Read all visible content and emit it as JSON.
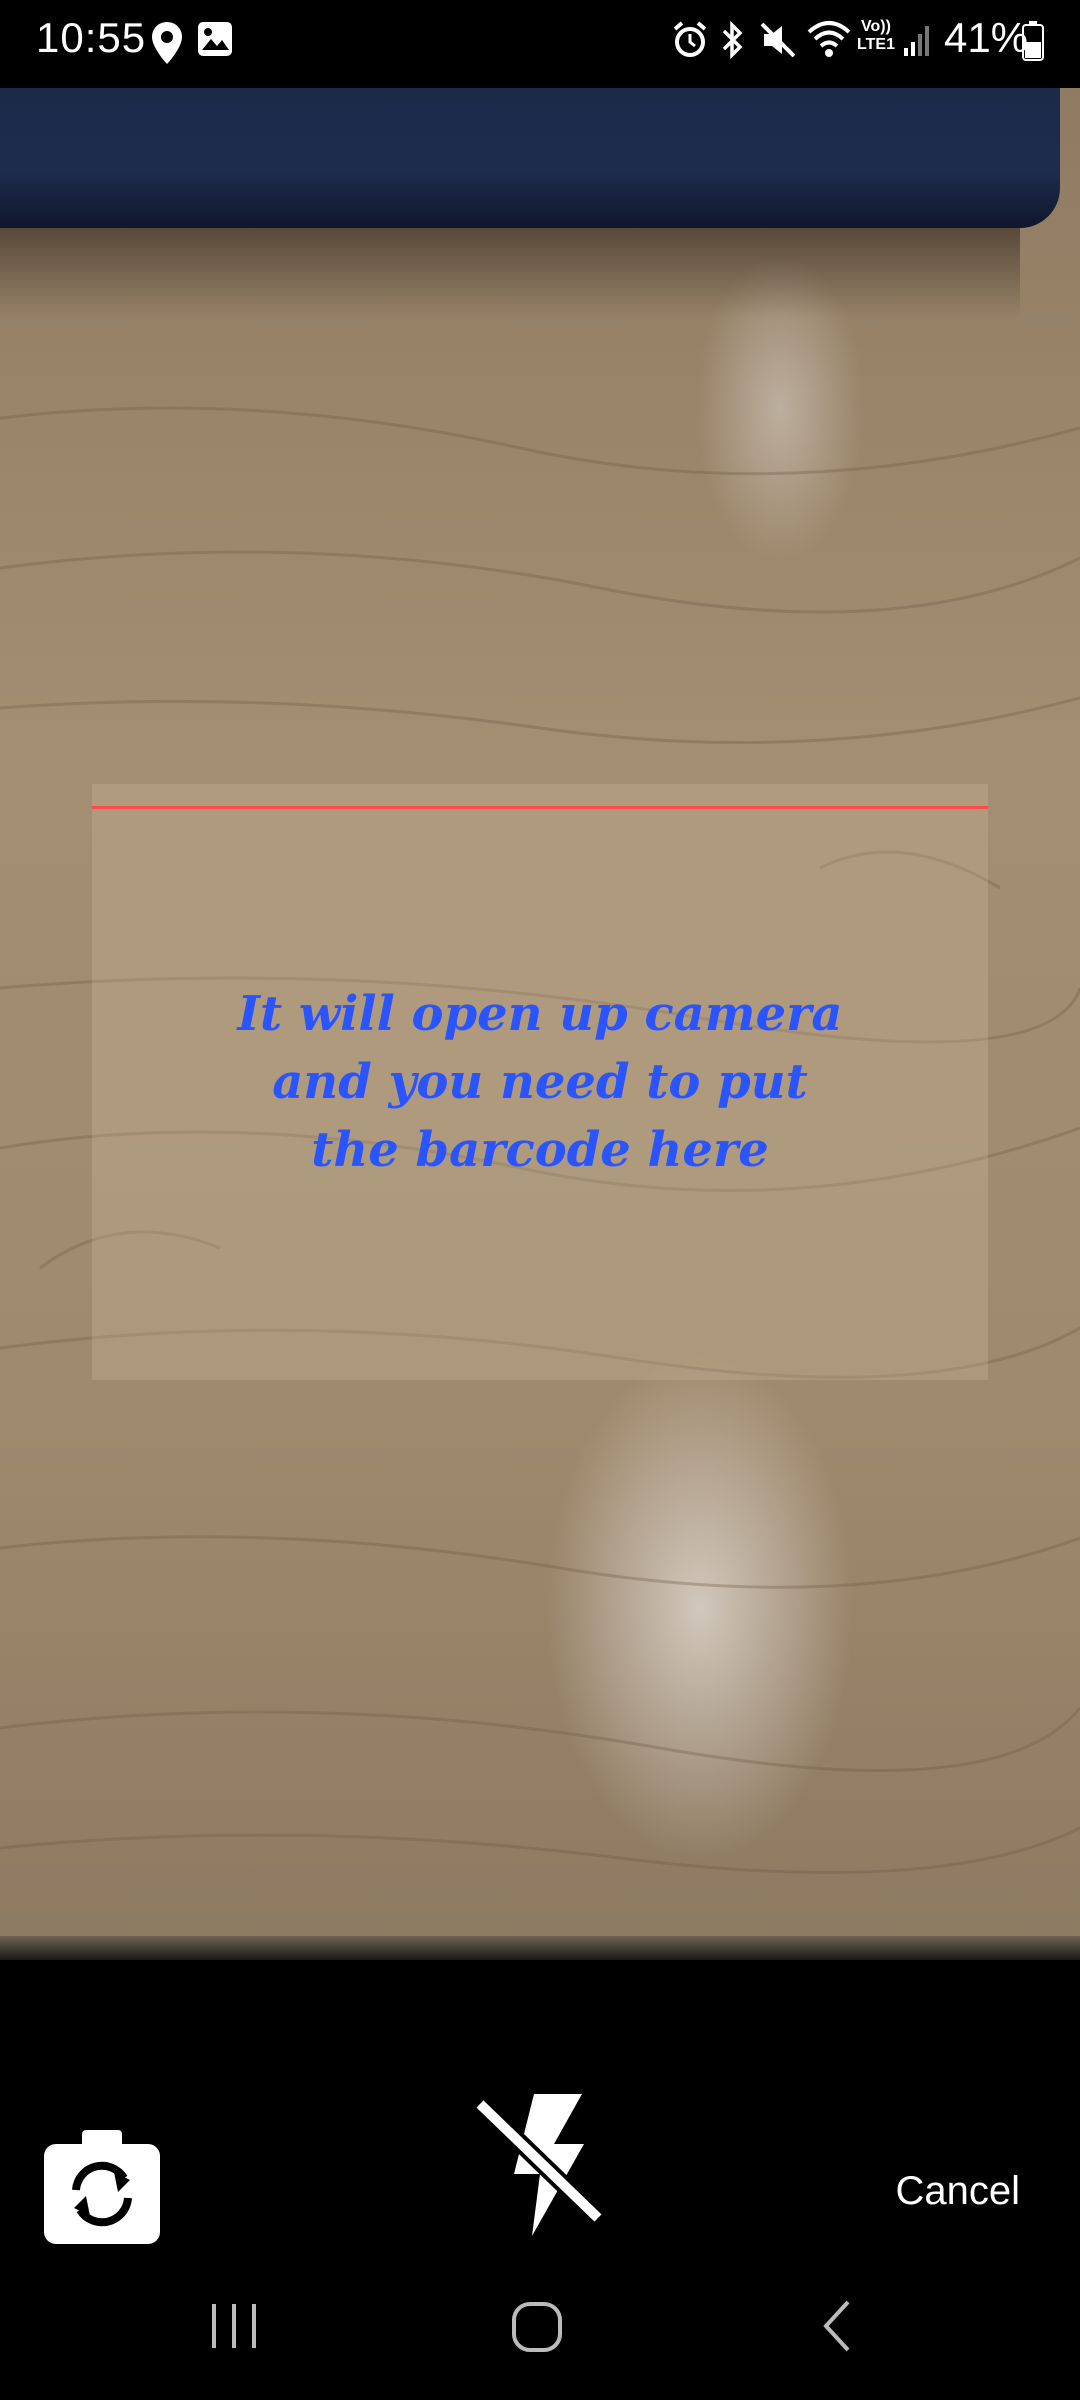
{
  "status_bar": {
    "time": "10:55",
    "battery_percent": "41%",
    "left_icons": [
      "location-icon",
      "gallery-icon"
    ],
    "right_icons": [
      "alarm-icon",
      "bluetooth-icon",
      "mute-icon",
      "wifi-icon",
      "volte-icon",
      "signal-icon",
      "battery-icon"
    ],
    "volte_label": "Vo))",
    "lte_label": "LTE1"
  },
  "scanner": {
    "instruction": "It will open up camera\nand you need to put\nthe barcode here",
    "laser_color": "#ff4a4a",
    "instruction_color": "#2a54ff"
  },
  "controls": {
    "switch_camera_icon": "switch-camera-icon",
    "flash_icon": "flash-off-icon",
    "cancel_label": "Cancel"
  },
  "navbar": {
    "icons": [
      "recent-apps-icon",
      "home-icon",
      "back-icon"
    ]
  }
}
